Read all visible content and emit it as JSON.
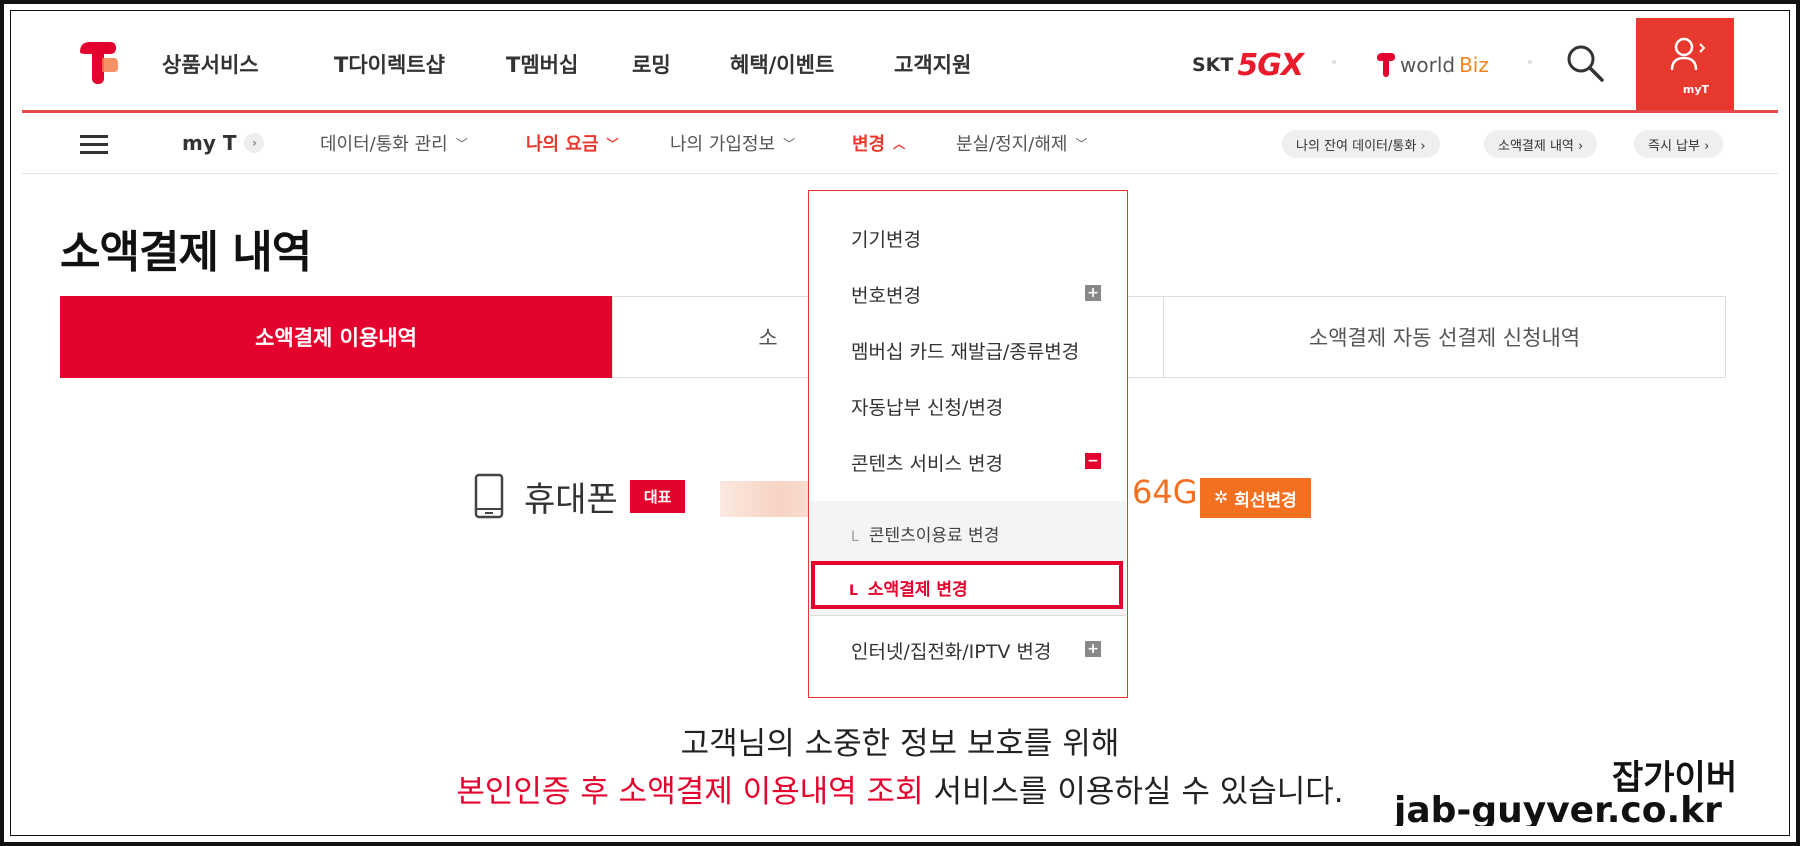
{
  "gnb": {
    "menu": [
      "상품서비스",
      "T다이렉트샵",
      "T멤버십",
      "로밍",
      "혜택/이벤트",
      "고객지원"
    ],
    "brand_skt": "SKT",
    "brand_5gx": "5GX",
    "brand_worldbiz_text": "world",
    "brand_worldbiz_biz": "Biz",
    "myt_label": "myT",
    "accent_color": "#e8392f"
  },
  "lnb": {
    "home": "my T",
    "items": [
      {
        "label": "데이터/통화 관리",
        "chevron": "chevron-down"
      },
      {
        "label": "나의 요금",
        "chevron": "chevron-down",
        "active": true
      },
      {
        "label": "나의 가입정보",
        "chevron": "chevron-down"
      },
      {
        "label": "변경",
        "chevron": "chevron-up",
        "active": true
      },
      {
        "label": "분실/정지/해제",
        "chevron": "chevron-down"
      }
    ],
    "quick_links": [
      "나의 잔여 데이터/통화 ›",
      "소액결제 내역 ›",
      "즉시 납부 ›"
    ]
  },
  "dropdown": {
    "items": [
      "기기변경",
      "번호변경",
      "멤버십 카드 재발급/종류변경",
      "자동납부 신청/변경",
      "콘텐츠 서비스 변경"
    ],
    "sub_items": [
      "콘텐츠이용료 변경",
      "소액결제 변경"
    ],
    "last_item": "인터넷/집전화/IPTV 변경",
    "sub_marker": "L"
  },
  "page": {
    "title": "소액결제 내역",
    "tabs": [
      "소액결제 이용내역",
      "소",
      "소액결제 자동 선결제 신청내역"
    ],
    "line_label": "휴대폰",
    "rep_badge": "대표",
    "capacity": "64G",
    "line_change": "회선변경",
    "notice_line1": "고객님의 소중한 정보 보호를 위해",
    "notice_red": "본인인증 후 소액결제 이용내역 조회",
    "notice_rest": " 서비스를 이용하실 수 있습니다."
  },
  "watermark": {
    "name": "잡가이버",
    "url": "jab-guyver.co.kr"
  }
}
